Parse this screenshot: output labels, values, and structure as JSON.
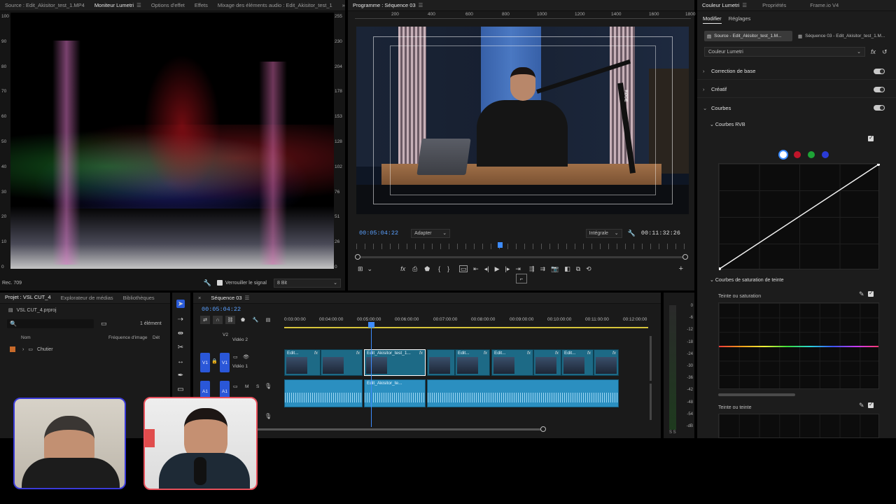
{
  "source_monitor": {
    "tabs": [
      {
        "label": "Source : Edit_Akisitor_test_1.MP4"
      },
      {
        "label": "Moniteur Lumetri"
      },
      {
        "label": "Options d'effet"
      },
      {
        "label": "Effets"
      },
      {
        "label": "Mixage des éléments audio : Edit_Akisitor_test_1"
      }
    ],
    "scale_left": [
      "100",
      "90",
      "80",
      "70",
      "60",
      "50",
      "40",
      "30",
      "20",
      "10",
      "0"
    ],
    "scale_right": [
      "255",
      "230",
      "204",
      "178",
      "153",
      "128",
      "102",
      "76",
      "51",
      "26",
      "0"
    ],
    "footer_left": "Rec. 709",
    "lock_label": "Verrouiller le signal",
    "bit_depth": "8 Bit"
  },
  "program_monitor": {
    "tab": "Programme : Séquence 03",
    "ruler": [
      "200",
      "400",
      "600",
      "800",
      "1000",
      "1200",
      "1400",
      "1600",
      "1800"
    ],
    "timecode_current": "00:05:04:22",
    "fit": "Adapter",
    "quality": "Intégrale",
    "timecode_duration": "00:11:32:26",
    "mic_brand": "RØDE"
  },
  "lumetri": {
    "tabs": [
      {
        "label": "Couleur Lumetri"
      },
      {
        "label": "Propriétés"
      },
      {
        "label": "Frame.io V4"
      }
    ],
    "subtabs": [
      {
        "label": "Modifier"
      },
      {
        "label": "Réglages"
      }
    ],
    "source_chip": "Source - Edit_Akisitor_test_1.M...",
    "sequence_chip": "Séquence 03 - Edit_Akisitor_test_1.M...",
    "effect_select": "Couleur Lumetri",
    "sections": [
      {
        "label": "Correction de base"
      },
      {
        "label": "Créatif"
      },
      {
        "label": "Courbes"
      }
    ],
    "rgb_curves": "Courbes RVB",
    "hue_sat_curves": "Courbes de saturation de teinte",
    "hue_vs_sat": "Teinte ou saturation",
    "hue_vs_hue": "Teinte ou teinte",
    "channel_colors": [
      "#ffffff",
      "#c0152a",
      "#1ea336",
      "#2a3bd6"
    ]
  },
  "project": {
    "tabs": [
      {
        "label": "Projet : VSL CUT_4"
      },
      {
        "label": "Explorateur de médias"
      },
      {
        "label": "Bibliothèques"
      }
    ],
    "file": "VSL CUT_4.prproj",
    "item_count": "1 élément",
    "columns": {
      "name": "Nom",
      "rate": "Fréquence d'image",
      "start": "Dét"
    },
    "rows": [
      {
        "name": "Chutier"
      }
    ]
  },
  "timeline": {
    "tab": "Séquence 03",
    "timecode": "00:05:04:22",
    "ruler": [
      "0:03:00:00",
      "00:04:00:00",
      "00:05:00:00",
      "00:06:00:00",
      "00:07:00:00",
      "00:08:00:00",
      "00:09:00:00",
      "00:10:00:00",
      "00:11:00:00",
      "00:12:00:00"
    ],
    "tracks": {
      "v2": "V2",
      "v2_name": "Vidéo 2",
      "v1": "V1",
      "v1_name": "Vidéo 1",
      "a1": "A1",
      "m": "M",
      "s": "S"
    },
    "clips": [
      {
        "label": "Edit..."
      },
      {
        "label": "Edit_Akisitor_test_1..."
      },
      {
        "label": "Edit..."
      },
      {
        "label": "Edit..."
      },
      {
        "label": "Edit..."
      }
    ],
    "audio_clip": "Edit_Akisitor_te..."
  },
  "meter": {
    "scale": [
      "0",
      "-6",
      "-12",
      "-18",
      "-24",
      "-30",
      "-36",
      "-42",
      "-48",
      "-54",
      "-dB"
    ],
    "footer": "S S"
  }
}
